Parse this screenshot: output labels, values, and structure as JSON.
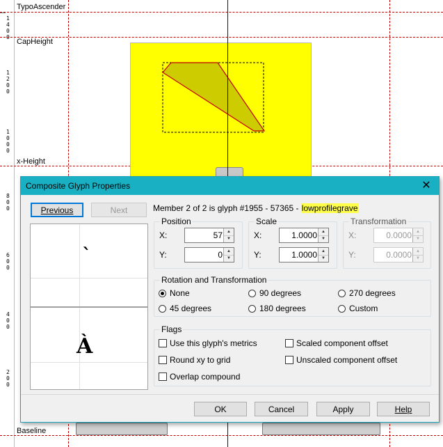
{
  "editor": {
    "guides": {
      "typo_ascender": "TypoAscender",
      "cap_height": "CapHeight",
      "x_height": "x-Height",
      "baseline": "Baseline"
    },
    "ruler_labels": [
      "1400",
      "1200",
      "1000",
      "800",
      "600",
      "400",
      "200"
    ],
    "colors": {
      "guide": "#c00000",
      "center_line": "#0000c8",
      "glyph_box": "#ffff00",
      "glyph_shape": "#cccc00",
      "glyph_outline": "#c00000"
    }
  },
  "dialog": {
    "title": "Composite Glyph Properties",
    "previous_label": "Previous",
    "next_label": "Next",
    "member_info_prefix": "Member 2 of 2 is glyph #1955 - 57365 - ",
    "glyph_name": "lowprofilegrave",
    "preview_top_glyph": "`",
    "preview_bottom_glyph": "À",
    "position": {
      "label": "Position",
      "x_label": "X:",
      "x_value": "57",
      "y_label": "Y:",
      "y_value": "0"
    },
    "scale": {
      "label": "Scale",
      "x_label": "X:",
      "x_value": "1.0000",
      "y_label": "Y:",
      "y_value": "1.0000"
    },
    "transformation": {
      "label": "Transformation",
      "x_label": "X:",
      "x_value": "0.0000",
      "y_label": "Y:",
      "y_value": "0.0000"
    },
    "rotation": {
      "label": "Rotation and Transformation",
      "options": [
        "None",
        "90 degrees",
        "270 degrees",
        "45 degrees",
        "180 degrees",
        "Custom"
      ],
      "selected": "None"
    },
    "flags": {
      "label": "Flags",
      "use_metrics": "Use this glyph's metrics",
      "scaled_offset": "Scaled component offset",
      "round_xy": "Round xy to grid",
      "unscaled_offset": "Unscaled component offset",
      "overlap": "Overlap compound"
    },
    "buttons": {
      "ok": "OK",
      "cancel": "Cancel",
      "apply": "Apply",
      "help": "Help"
    },
    "colors": {
      "titlebar": "#1ab0c3",
      "highlight": "#ffff4a"
    }
  }
}
